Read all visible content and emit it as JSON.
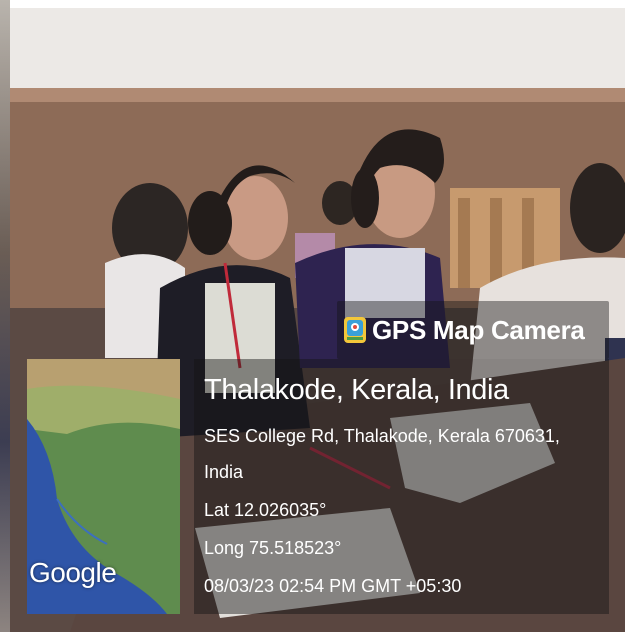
{
  "badge": {
    "title": "GPS Map Camera",
    "icon": "gps-map-camera-app-icon"
  },
  "location": {
    "place": "Thalakode, Kerala, India",
    "address_line1": "SES College Rd, Thalakode, Kerala 670631,",
    "address_line2": "India",
    "latitude": "Lat 12.026035°",
    "longitude": "Long 75.518523°",
    "timestamp": "08/03/23 02:54 PM GMT +05:30"
  },
  "map": {
    "attribution": "Google"
  },
  "colors": {
    "overlay": "#141414",
    "text": "#ffffff",
    "wall": "#8d6b57",
    "map_land": "#5f8c4e",
    "map_sea": "#2f55a8"
  }
}
